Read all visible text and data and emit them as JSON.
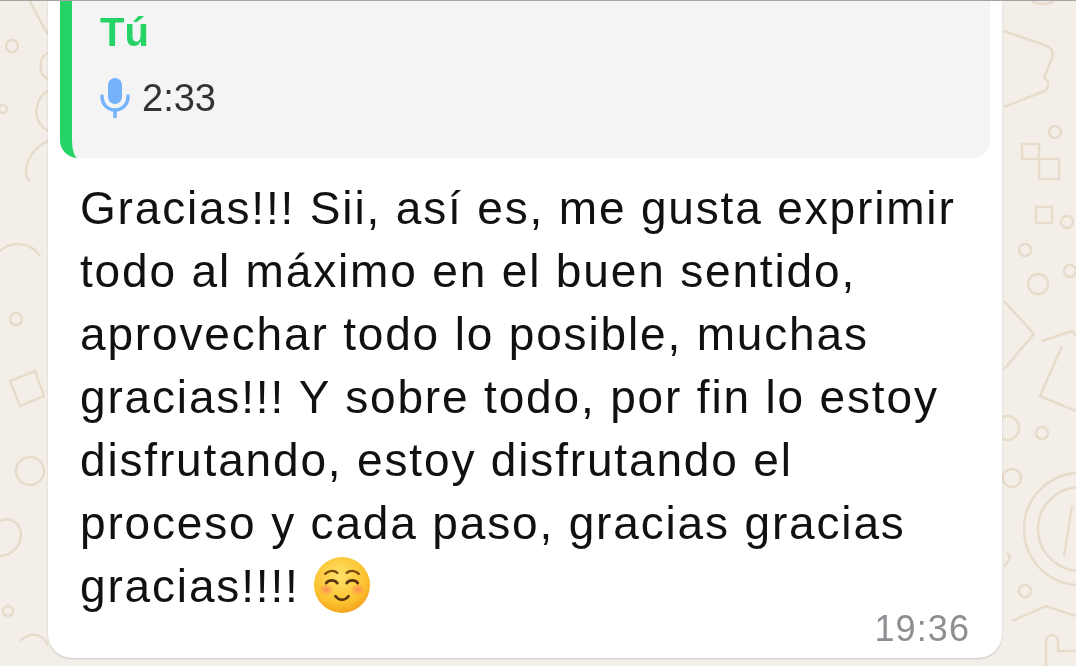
{
  "reply_quote": {
    "sender": "Tú",
    "voice_note_duration": "2:33"
  },
  "message": {
    "text": "Gracias!!! Sii, así es, me gusta exprimir todo al máximo en el buen sentido, aprovechar todo lo posible, muchas gracias!!! Y sobre todo, por fin lo estoy disfrutando, estoy disfrutando el proceso y cada paso, gracias gracias gracias!!!!",
    "time": "19:36"
  }
}
